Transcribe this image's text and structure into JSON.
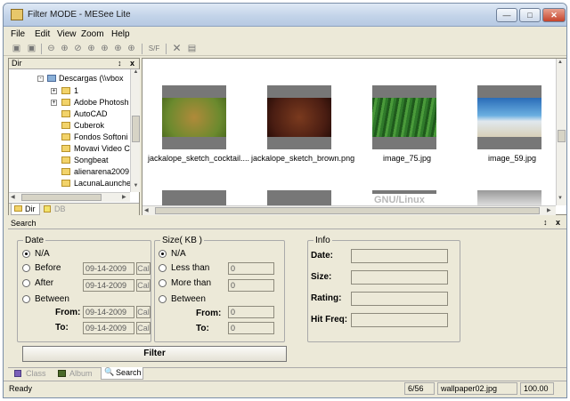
{
  "window": {
    "title": "Filter MODE - MESee Lite"
  },
  "menu": [
    "File",
    "Edit",
    "View",
    "Zoom",
    "Help"
  ],
  "toolbar": {
    "sf_label": "S/F"
  },
  "dir": {
    "title": "Dir",
    "pin": "↕",
    "close": "x",
    "root": "Descargas (\\\\vbox",
    "items": [
      "1",
      "Adobe Photosh",
      "AutoCAD",
      "Cuberok",
      "Fondos Softoni",
      "Movavi Video C",
      "Songbeat",
      "alienarena2009",
      "LacunaLaunche"
    ],
    "tab_dir": "Dir",
    "tab_db": "DB"
  },
  "thumbnails": [
    {
      "name": "jackalope_sketch_cocktail....",
      "color": "#6b8a2e"
    },
    {
      "name": "jackalope_sketch_brown.png",
      "color": "#4a1d12"
    },
    {
      "name": "image_75.jpg",
      "color": "#2f7a2a"
    },
    {
      "name": "image_59.jpg",
      "color": "#4a90c8"
    }
  ],
  "thumb_row2_text": "GNU/Linux",
  "search": {
    "title": "Search",
    "date": {
      "label": "Date",
      "options": [
        "N/A",
        "Before",
        "After",
        "Between"
      ],
      "before_value": "09-14-2009",
      "after_value": "09-14-2009",
      "from_label": "From:",
      "to_label": "To:",
      "from_value": "09-14-2009",
      "to_value": "09-14-2009",
      "cal": "Cal"
    },
    "size": {
      "label": "Size( KB )",
      "options": [
        "N/A",
        "Less than",
        "More than",
        "Between"
      ],
      "less_value": "0",
      "more_value": "0",
      "from_label": "From:",
      "to_label": "To:",
      "from_value": "0",
      "to_value": "0"
    },
    "info": {
      "label": "Info",
      "fields": [
        "Date:",
        "Size:",
        "Rating:",
        "Hit Freq:"
      ]
    },
    "filter_button": "Filter"
  },
  "bottom_tabs": [
    "Class",
    "Album",
    "Search"
  ],
  "status": {
    "text": "Ready",
    "count": "6/56",
    "file": "wallpaper02.jpg",
    "zoom": "100.00"
  }
}
